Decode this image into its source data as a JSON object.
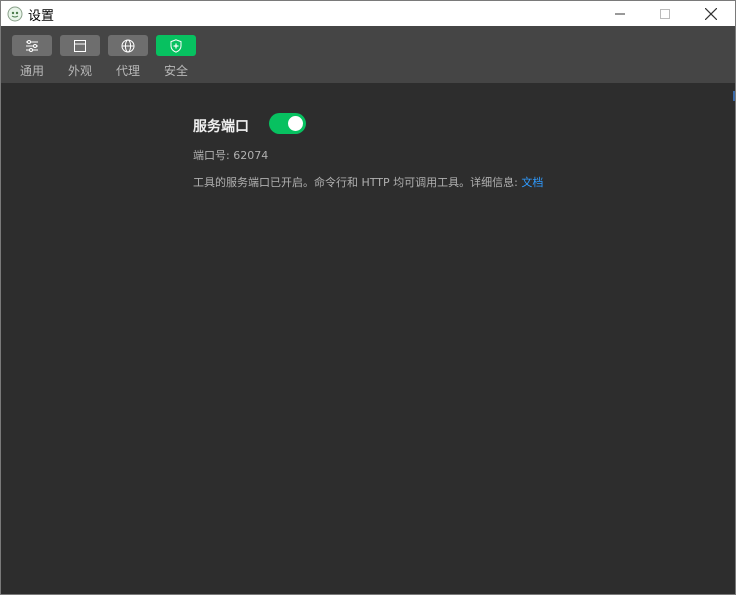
{
  "window": {
    "title": "设置",
    "minimize_label": "—",
    "maximize_label": "☐",
    "close_label": "✕"
  },
  "toolbar": {
    "items": [
      {
        "label": "通用",
        "icon": "sliders-icon",
        "active": false
      },
      {
        "label": "外观",
        "icon": "window-layout-icon",
        "active": false
      },
      {
        "label": "代理",
        "icon": "globe-icon",
        "active": false
      },
      {
        "label": "安全",
        "icon": "shield-icon",
        "active": true
      }
    ]
  },
  "service_port": {
    "title": "服务端口",
    "enabled": true,
    "port_label": "端口号: ",
    "port_value": "62074",
    "description": "工具的服务端口已开启。命令行和 HTTP 均可调用工具。详细信息: ",
    "doc_link": "文档"
  },
  "colors": {
    "accent": "#07c160",
    "link": "#2f9bff",
    "background": "#2d2d2d",
    "toolbar": "#454545"
  }
}
